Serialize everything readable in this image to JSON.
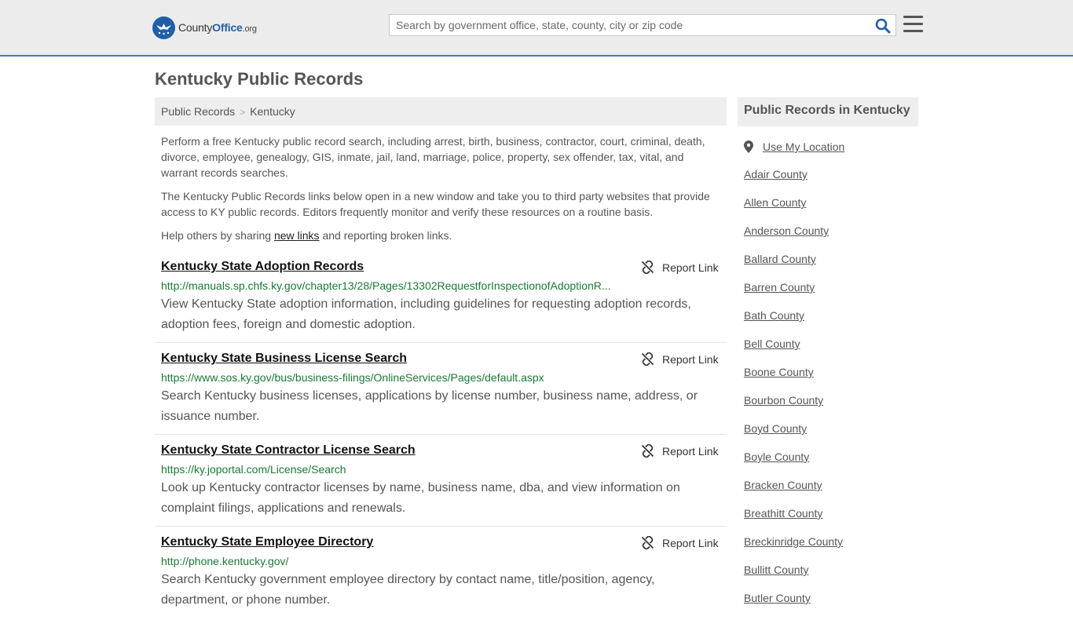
{
  "header": {
    "logo_county": "County",
    "logo_office": "Office",
    "logo_org": ".org",
    "search_placeholder": "Search by government office, state, county, city or zip code"
  },
  "page": {
    "title": "Kentucky Public Records",
    "breadcrumb": [
      "Public Records",
      "Kentucky"
    ],
    "intro1": "Perform a free Kentucky public record search, including arrest, birth, business, contractor, court, criminal, death, divorce, employee, genealogy, GIS, inmate, jail, land, marriage, police, property, sex offender, tax, vital, and warrant records searches.",
    "intro2": "The Kentucky Public Records links below open in a new window and take you to third party websites that provide access to KY public records. Editors frequently monitor and verify these resources on a routine basis.",
    "help_prefix": "Help others by sharing ",
    "help_link": "new links",
    "help_suffix": " and reporting broken links."
  },
  "records": [
    {
      "title": "Kentucky State Adoption Records",
      "url": "http://manuals.sp.chfs.ky.gov/chapter13/28/Pages/13302RequestforInspectionofAdoptionR...",
      "desc": "View Kentucky State adoption information, including guidelines for requesting adoption records, adoption fees, foreign and domestic adoption.",
      "report": "Report Link"
    },
    {
      "title": "Kentucky State Business License Search",
      "url": "https://www.sos.ky.gov/bus/business-filings/OnlineServices/Pages/default.aspx",
      "desc": "Search Kentucky business licenses, applications by license number, business name, address, or issuance number.",
      "report": "Report Link"
    },
    {
      "title": "Kentucky State Contractor License Search",
      "url": "https://ky.joportal.com/License/Search",
      "desc": "Look up Kentucky contractor licenses by name, business name, dba, and view information on complaint filings, applications and renewals.",
      "report": "Report Link"
    },
    {
      "title": "Kentucky State Employee Directory",
      "url": "http://phone.kentucky.gov/",
      "desc": "Search Kentucky government employee directory by contact name, title/position, agency, department, or phone number.",
      "report": "Report Link"
    }
  ],
  "sidebar": {
    "title": "Public Records in Kentucky",
    "use_location": "Use My Location",
    "counties": [
      "Adair County",
      "Allen County",
      "Anderson County",
      "Ballard County",
      "Barren County",
      "Bath County",
      "Bell County",
      "Boone County",
      "Bourbon County",
      "Boyd County",
      "Boyle County",
      "Bracken County",
      "Breathitt County",
      "Breckinridge County",
      "Bullitt County",
      "Butler County"
    ]
  },
  "colors": {
    "accent": "#3d7fc1",
    "url_green": "#1a7a36",
    "logo_blue": "#1f5fa8"
  }
}
